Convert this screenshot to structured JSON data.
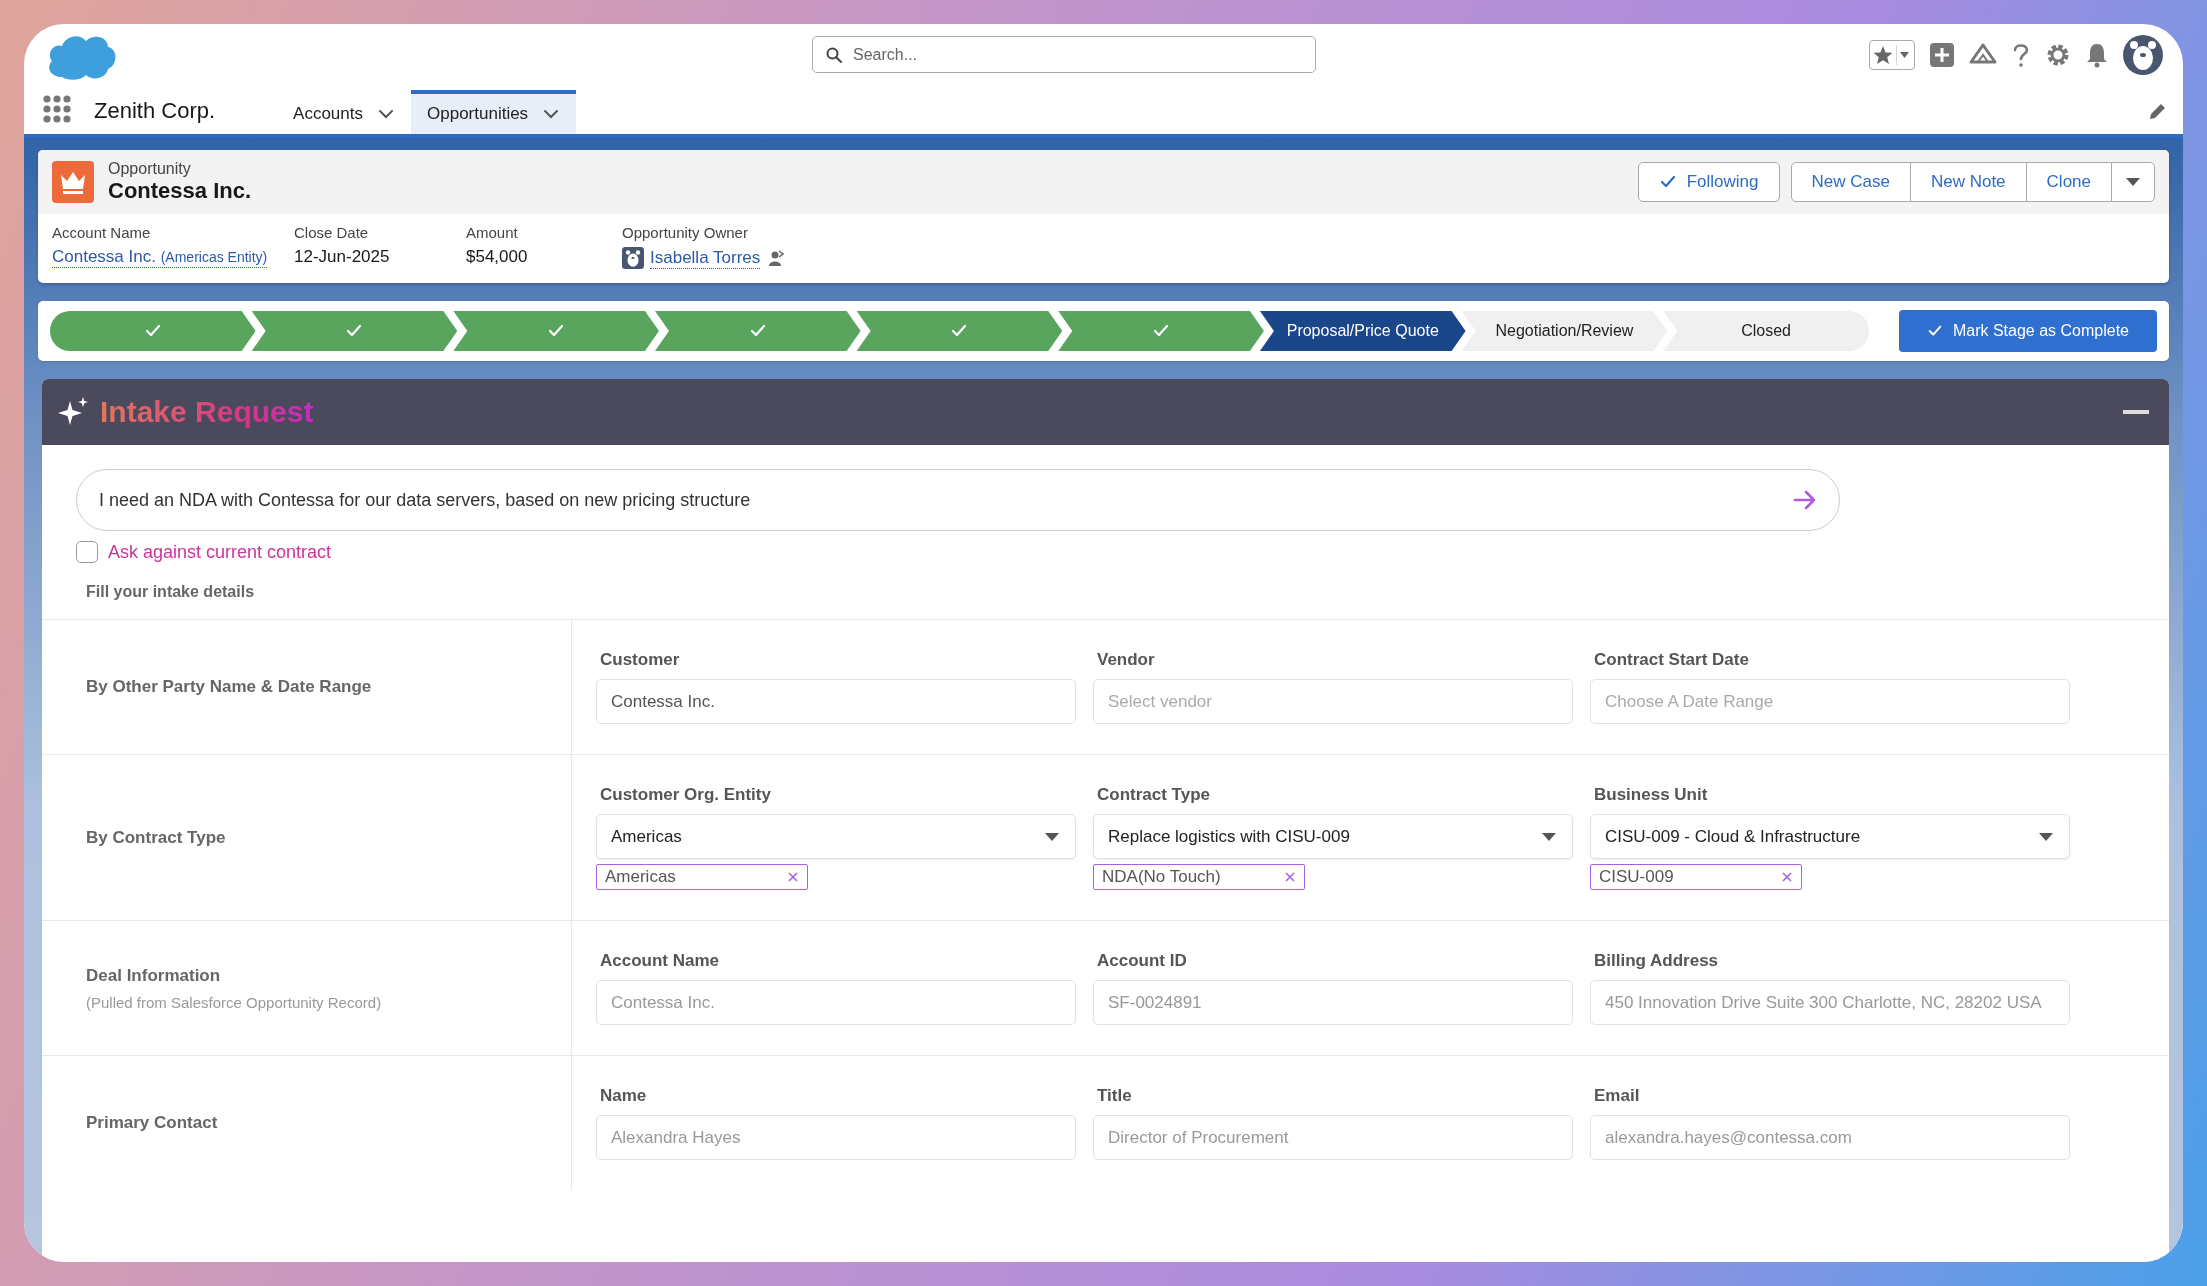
{
  "app": {
    "name": "Zenith Corp.",
    "search": {
      "placeholder": "Search..."
    }
  },
  "nav_tabs": [
    {
      "label": "Accounts",
      "selected": false
    },
    {
      "label": "Opportunities",
      "selected": true
    }
  ],
  "record": {
    "type": "Opportunity",
    "name": "Contessa Inc.",
    "actions": [
      {
        "label": "Following",
        "kind": "toggle"
      },
      {
        "label": "New Case",
        "kind": "button"
      },
      {
        "label": "New Note",
        "kind": "button"
      },
      {
        "label": "Clone",
        "kind": "button"
      },
      {
        "kind": "menu"
      }
    ],
    "fields": [
      {
        "label": "Account Name",
        "kind": "link",
        "value": "Contessa Inc.",
        "note": "(Americas Entity)"
      },
      {
        "label": "Close Date",
        "kind": "text",
        "value": "12-Jun-2025"
      },
      {
        "label": "Amount",
        "kind": "text",
        "value": "$54,000"
      },
      {
        "label": "Opportunity Owner",
        "kind": "owner",
        "value": "Isabella Torres"
      }
    ]
  },
  "path": {
    "stages": [
      {
        "completed": true,
        "selected": false
      },
      {
        "completed": true,
        "selected": false
      },
      {
        "completed": true,
        "selected": false
      },
      {
        "completed": true,
        "selected": false
      },
      {
        "completed": true,
        "selected": false
      },
      {
        "completed": true,
        "selected": false
      },
      {
        "completed": false,
        "selected": true,
        "label": "Proposal/Price Quote"
      },
      {
        "completed": false,
        "selected": false,
        "label": "Negotiation/Review"
      },
      {
        "completed": false,
        "selected": false,
        "label": "Closed"
      }
    ],
    "button": "Mark Stage as Complete"
  },
  "intake": {
    "title": "Intake Request",
    "prompt": {
      "value": "I need an NDA with Contessa for our data servers, based on new pricing structure"
    },
    "ask_current": {
      "label": "Ask against current contract",
      "checked": false
    },
    "subtitle": "Fill your intake details",
    "sections": [
      {
        "label": "By Other Party Name & Date Range",
        "fields": [
          {
            "label": "Customer",
            "kind": "text",
            "value": "Contessa Inc."
          },
          {
            "label": "Vendor",
            "kind": "text",
            "placeholder": "Select vendor"
          },
          {
            "label": "Contract Start Date",
            "kind": "text",
            "placeholder": "Choose A Date Range"
          }
        ]
      },
      {
        "label": "By Contract Type",
        "fields": [
          {
            "label": "Customer Org. Entity",
            "kind": "select",
            "value": "Americas",
            "tags": [
              "Americas"
            ]
          },
          {
            "label": "Contract Type",
            "kind": "select",
            "value": "Replace logistics with CISU-009",
            "tags": [
              "NDA(No Touch)"
            ]
          },
          {
            "label": "Business Unit",
            "kind": "select",
            "value": "CISU-009 - Cloud & Infrastructure",
            "tags": [
              "CISU-009"
            ]
          }
        ]
      },
      {
        "label": "Deal Information",
        "note": "(Pulled from Salesforce Opportunity Record)",
        "fields": [
          {
            "label": "Account Name",
            "kind": "text",
            "value": "Contessa Inc.",
            "disabled": true
          },
          {
            "label": "Account ID",
            "kind": "text",
            "value": "SF-0024891",
            "disabled": true
          },
          {
            "label": "Billing Address",
            "kind": "text",
            "value": "450 Innovation Drive Suite 300 Charlotte, NC, 28202 USA",
            "disabled": true
          }
        ]
      },
      {
        "label": "Primary Contact",
        "fields": [
          {
            "label": "Name",
            "kind": "text",
            "value": "Alexandra Hayes",
            "disabled": true
          },
          {
            "label": "Title",
            "kind": "text",
            "value": "Director of Procurement",
            "disabled": true
          },
          {
            "label": "Email",
            "kind": "text",
            "value": "alexandra.hayes@contessa.com",
            "disabled": true
          }
        ]
      }
    ]
  }
}
